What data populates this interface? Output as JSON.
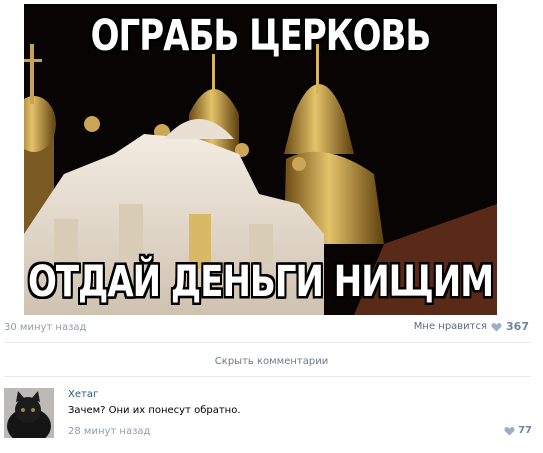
{
  "post": {
    "image_caption_top": "ОГРАБЬ ЦЕРКОВЬ",
    "image_caption_bottom": "ОТДАЙ ДЕНЬГИ НИЩИМ",
    "time": "30 минут назад",
    "like_label": "Мне нравится",
    "like_count": "367"
  },
  "hide_comments_label": "Скрыть комментарии",
  "comment": {
    "author": "Хетаг",
    "text": "Зачем? Они их понесут обратно.",
    "time": "28 минут назад",
    "like_count": "77"
  },
  "colors": {
    "link": "#2b587a",
    "muted": "#8f9bab",
    "like": "#6d84a3",
    "divider": "#e7eaef"
  },
  "icons": [
    "heart-icon",
    "avatar-image",
    "church-photo"
  ]
}
